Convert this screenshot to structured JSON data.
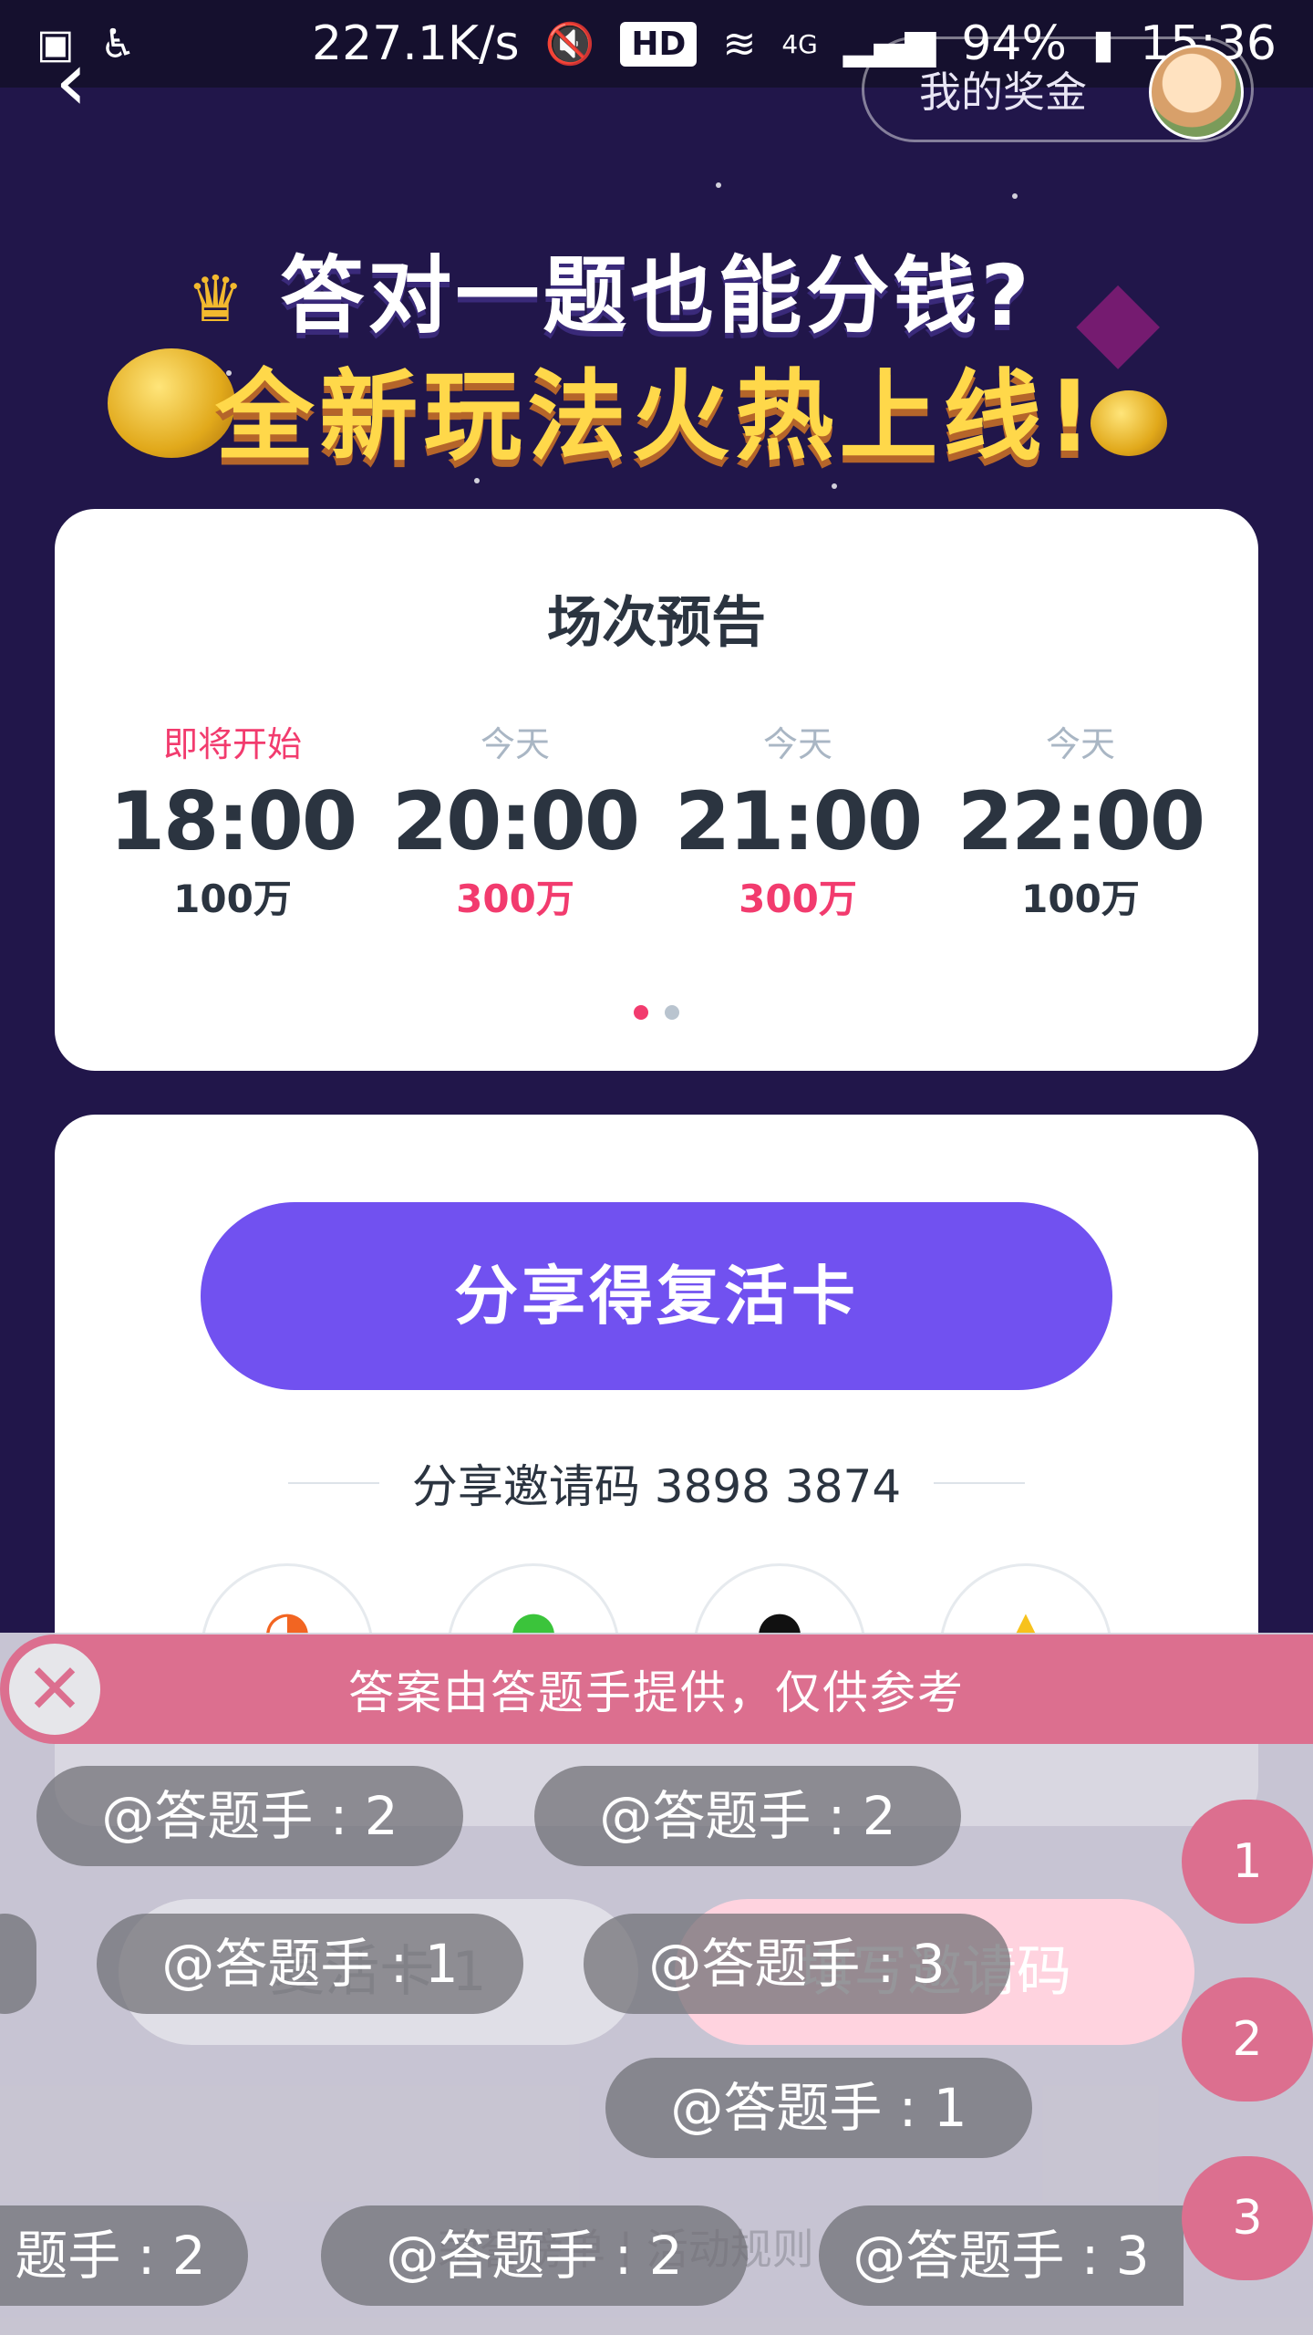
{
  "status_bar": {
    "speed": "227.1K/s",
    "hd": "HD",
    "network": "4G",
    "battery": "94%",
    "time": "15:36"
  },
  "nav": {
    "back_glyph": "‹",
    "bonus_label": "我的奖金"
  },
  "hero": {
    "line1": "答对一题也能分钱?",
    "line2": "全新玩法火热上线!"
  },
  "schedule": {
    "title": "场次预告",
    "sessions": [
      {
        "label": "即将开始",
        "time": "18:00",
        "prize": "100万"
      },
      {
        "label": "今天",
        "time": "20:00",
        "prize": "300万"
      },
      {
        "label": "今天",
        "time": "21:00",
        "prize": "300万"
      },
      {
        "label": "今天",
        "time": "22:00",
        "prize": "100万"
      }
    ]
  },
  "share": {
    "button_label": "分享得复活卡",
    "invite_text": "分享邀请码 3898 3874"
  },
  "overlay": {
    "banner_text": "答案由答题手提供，仅供参考",
    "close_glyph": "✕",
    "ghost_revive": "复活卡 1",
    "ghost_code": "填写邀请码",
    "ghost_links": "荣誉榜单 | 活动规则",
    "bubbles": [
      "@答题手 : 2",
      "@答题手 : 2",
      "@答题手 : 1",
      "@答题手 : 3",
      "@答题手 : 1",
      "题手 : 2",
      "@答题手 : 2",
      "@答题手 : 3"
    ],
    "options": [
      "1",
      "2",
      "3"
    ]
  },
  "colors": {
    "background": "#21164a",
    "accent_purple": "#7151f0",
    "accent_pink": "#f23b6e",
    "overlay_pink": "#dc6f8f",
    "gold": "#ffd84a"
  }
}
